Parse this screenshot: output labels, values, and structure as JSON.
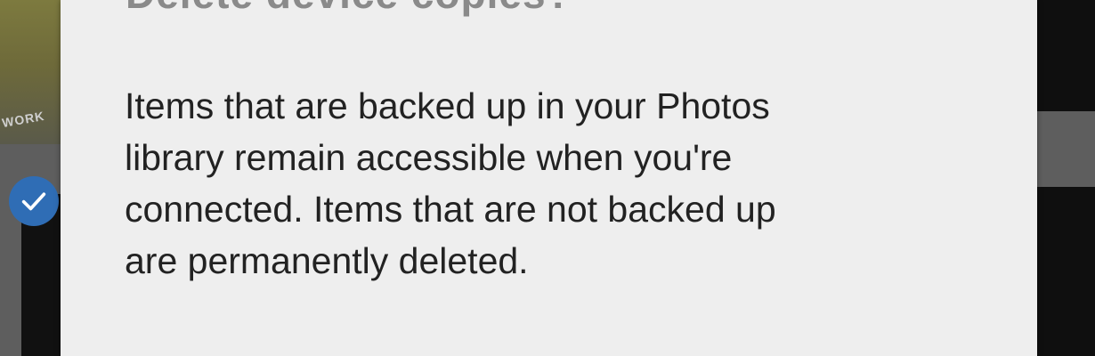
{
  "dialog": {
    "title": "Delete device copies?",
    "message_lines": [
      "Items that are backed up in your Photos",
      "library remain accessible when you're",
      "connected. Items that are not backed up",
      "are permanently deleted."
    ]
  },
  "background": {
    "photo_text": "WORK",
    "selected_check_icon": "checkmark-icon",
    "accent_color": "#2f6db5"
  }
}
